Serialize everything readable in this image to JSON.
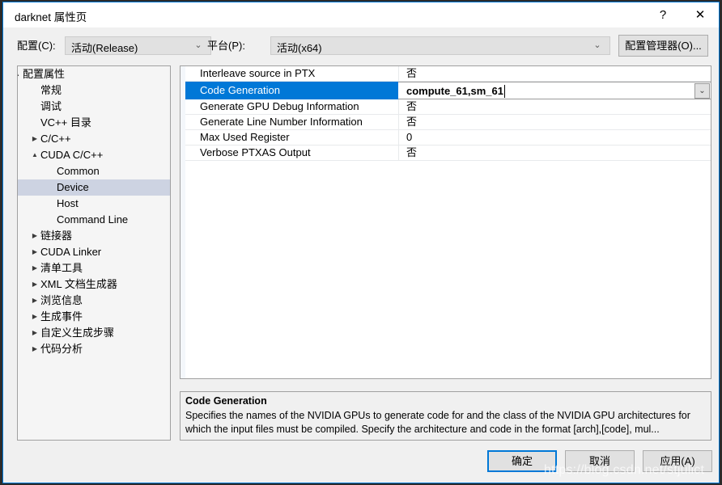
{
  "window": {
    "title": "darknet 属性页",
    "help_icon": "?",
    "close_icon": "✕",
    "accent_color": "#0078d7"
  },
  "config_bar": {
    "config_label": "配置(C):",
    "config_value": "活动(Release)",
    "platform_label": "平台(P):",
    "platform_value": "活动(x64)",
    "dropdown_icon": "⌄",
    "config_manager_label": "配置管理器(O)..."
  },
  "tree": {
    "items": [
      {
        "label": "配置属性",
        "indent": 6,
        "arrow": "▲",
        "selected": false
      },
      {
        "label": "常规",
        "indent": 28,
        "arrow": "",
        "selected": false
      },
      {
        "label": "调试",
        "indent": 28,
        "arrow": "",
        "selected": false
      },
      {
        "label": "VC++ 目录",
        "indent": 28,
        "arrow": "",
        "selected": false
      },
      {
        "label": "C/C++",
        "indent": 28,
        "arrow": "▶",
        "selected": false
      },
      {
        "label": "CUDA C/C++",
        "indent": 28,
        "arrow": "▲",
        "selected": false
      },
      {
        "label": "Common",
        "indent": 48,
        "arrow": "",
        "selected": false
      },
      {
        "label": "Device",
        "indent": 48,
        "arrow": "",
        "selected": true
      },
      {
        "label": "Host",
        "indent": 48,
        "arrow": "",
        "selected": false
      },
      {
        "label": "Command Line",
        "indent": 48,
        "arrow": "",
        "selected": false
      },
      {
        "label": "链接器",
        "indent": 28,
        "arrow": "▶",
        "selected": false
      },
      {
        "label": "CUDA Linker",
        "indent": 28,
        "arrow": "▶",
        "selected": false
      },
      {
        "label": "清单工具",
        "indent": 28,
        "arrow": "▶",
        "selected": false
      },
      {
        "label": "XML 文档生成器",
        "indent": 28,
        "arrow": "▶",
        "selected": false
      },
      {
        "label": "浏览信息",
        "indent": 28,
        "arrow": "▶",
        "selected": false
      },
      {
        "label": "生成事件",
        "indent": 28,
        "arrow": "▶",
        "selected": false
      },
      {
        "label": "自定义生成步骤",
        "indent": 28,
        "arrow": "▶",
        "selected": false
      },
      {
        "label": "代码分析",
        "indent": 28,
        "arrow": "▶",
        "selected": false
      }
    ]
  },
  "grid": {
    "rows": [
      {
        "name": "Interleave source in PTX",
        "value": "否"
      },
      {
        "name": "Generate GPU Debug Information",
        "value": "否"
      },
      {
        "name": "Generate Line Number Information",
        "value": "否"
      },
      {
        "name": "Max Used Register",
        "value": "0"
      },
      {
        "name": "Verbose PTXAS Output",
        "value": "否"
      }
    ],
    "selected_row": {
      "name": "Code Generation",
      "value": "compute_61,sm_61",
      "dropdown_icon": "⌄"
    }
  },
  "description": {
    "title": "Code Generation",
    "body": "Specifies the names of the NVIDIA GPUs to generate code for and the class of the NVIDIA GPU architectures for which the input files must be compiled.  Specify the architecture and code in the format [arch],[code], mul..."
  },
  "buttons": {
    "ok": "确定",
    "cancel": "取消",
    "apply": "应用(A)"
  },
  "watermark": {
    "text": "https://blog.csdn.net/stjulict"
  }
}
